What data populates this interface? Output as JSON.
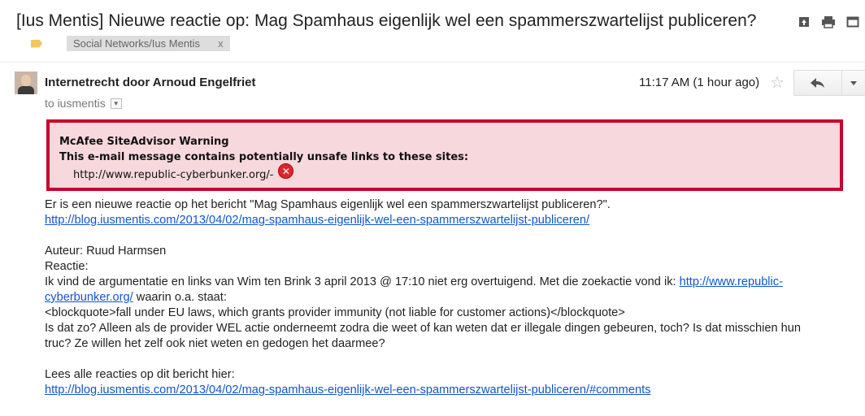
{
  "subject": "[Ius Mentis] Nieuwe reactie op: Mag Spamhaus eigenlijk wel een spammerszwartelijst publiceren?",
  "label": {
    "name": "Social Networks/Ius Mentis",
    "remove": "x"
  },
  "sender": "Internetrecht door Arnoud Engelfriet",
  "recipient": "to iusmentis",
  "time": "11:17 AM (1 hour ago)",
  "warning": {
    "title": "McAfee SiteAdvisor Warning",
    "message": "This e-mail message contains potentially unsafe links to these sites:",
    "site": "http://www.republic-cyberbunker.org/-"
  },
  "body": {
    "intro": "Er is een nieuwe reactie op het bericht \"Mag Spamhaus eigenlijk wel een spammerszwartelijst publiceren?\".",
    "post_link": "http://blog.iusmentis.com/2013/04/02/mag-spamhaus-eigenlijk-wel-een-spammerszwartelijst-publiceren/",
    "author": "Auteur: Ruud Harmsen",
    "reaction_label": "Reactie:",
    "line1_pre": "Ik vind de argumentatie en links van Wim ten Brink 3 april 2013 @ 17:10 niet erg overtuigend. Met die zoekactie vond ik: ",
    "line1_link_a": "http://www.republic-",
    "line2_link_b": "cyberbunker.org/",
    "line2_post": " waarin o.a. staat:",
    "quote": "<blockquote>fall under EU laws, which grants provider immunity (not liable for customer actions)</blockquote>",
    "question1": "Is dat zo? Alleen als de provider WEL actie onderneemt zodra die weet of kan weten dat er illegale dingen gebeuren, toch? Is dat misschien hun",
    "question2": "truc? Ze willen het zelf ook niet weten en gedogen het daarmee?",
    "all_reactions": "Lees alle reacties op dit bericht hier:",
    "comments_link": "http://blog.iusmentis.com/2013/04/02/mag-spamhaus-eigenlijk-wel-een-spammerszwartelijst-publiceren/#comments"
  },
  "colors": {
    "warning_border": "#c8002b",
    "warning_bg": "#f7d9dd",
    "link": "#1155cc"
  }
}
